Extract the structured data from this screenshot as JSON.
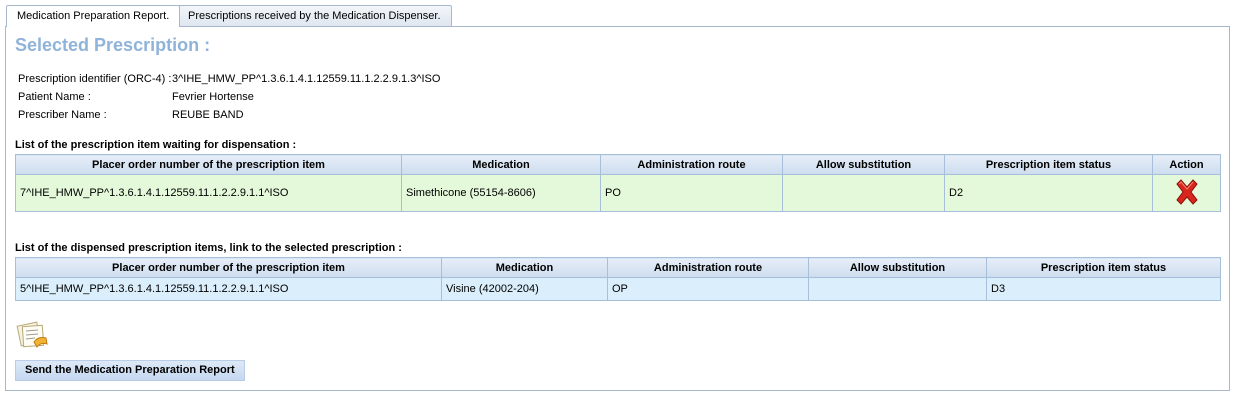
{
  "tabs": [
    {
      "label": "Medication Preparation Report."
    },
    {
      "label": "Prescriptions received by the Medication Dispenser."
    }
  ],
  "page": {
    "title": "Selected Prescription :",
    "info": [
      {
        "label": "Prescription identifier (ORC-4) :",
        "value": "3^IHE_HMW_PP^1.3.6.1.4.1.12559.11.1.2.2.9.1.3^ISO"
      },
      {
        "label": "Patient Name :",
        "value": "Fevrier Hortense"
      },
      {
        "label": "Prescriber Name :",
        "value": "REUBE BAND"
      }
    ]
  },
  "waiting": {
    "label": "List of the prescription item waiting for dispensation :",
    "headers": [
      "Placer order number of the prescription item",
      "Medication",
      "Administration route",
      "Allow substitution",
      "Prescription item status",
      "Action"
    ],
    "rows": [
      {
        "placer": "7^IHE_HMW_PP^1.3.6.1.4.1.12559.11.1.2.2.9.1.1^ISO",
        "medication": "Simethicone (55154-8606)",
        "route": "PO",
        "substitution": "",
        "status": "D2",
        "action_icon": "delete-x-icon"
      }
    ]
  },
  "dispensed": {
    "label": "List of the dispensed prescription items, link to the selected prescription :",
    "headers": [
      "Placer order number of the prescription item",
      "Medication",
      "Administration route",
      "Allow substitution",
      "Prescription item status"
    ],
    "rows": [
      {
        "placer": "5^IHE_HMW_PP^1.3.6.1.4.1.12559.11.1.2.2.9.1.1^ISO",
        "medication": "Visine (42002-204)",
        "route": "OP",
        "substitution": "",
        "status": "D3"
      }
    ]
  },
  "icons": {
    "report": "document-report-icon"
  },
  "send_button": {
    "label": "Send the Medication Preparation Report"
  },
  "colors": {
    "title": "#8fb3d9",
    "waiting_row": "#e4f8da",
    "dispensed_row": "#dbeefb",
    "header": "#cddcee"
  }
}
